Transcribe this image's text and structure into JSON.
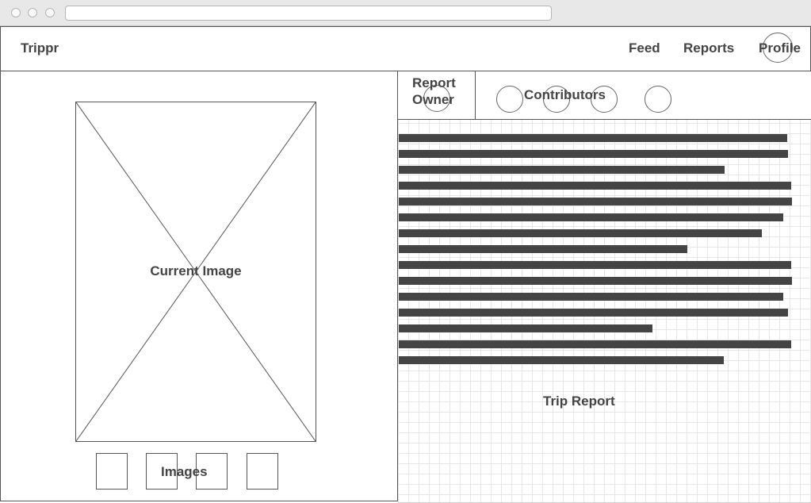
{
  "nav": {
    "brand": "Trippr",
    "links": [
      "Feed",
      "Reports",
      "Profile"
    ]
  },
  "left": {
    "current_image_label": "Current Image",
    "images_label": "Images"
  },
  "right": {
    "owner_label_line1": "Report",
    "owner_label_line2": "Owner",
    "contributors_label": "Contributors",
    "trip_report_label": "Trip Report"
  }
}
